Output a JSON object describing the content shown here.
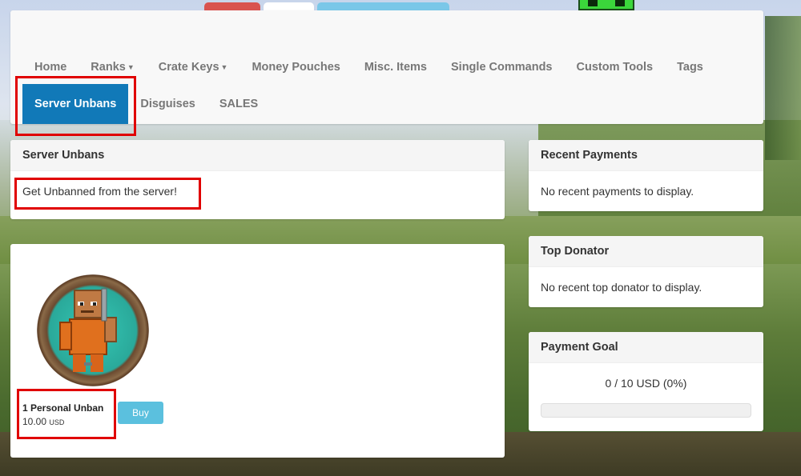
{
  "nav": {
    "row1": [
      {
        "label": "Home",
        "dropdown": false
      },
      {
        "label": "Ranks",
        "dropdown": true
      },
      {
        "label": "Crate Keys",
        "dropdown": true
      },
      {
        "label": "Money Pouches",
        "dropdown": false
      },
      {
        "label": "Misc. Items",
        "dropdown": false
      },
      {
        "label": "Single Commands",
        "dropdown": false
      },
      {
        "label": "Custom Tools",
        "dropdown": false
      },
      {
        "label": "Tags",
        "dropdown": false
      }
    ],
    "row2": [
      {
        "label": "Server Unbans",
        "active": true
      },
      {
        "label": "Disguises",
        "active": false
      },
      {
        "label": "SALES",
        "active": false
      }
    ],
    "active_color": "#1179b8"
  },
  "category": {
    "title": "Server Unbans",
    "description": "Get Unbanned from the server!"
  },
  "package": {
    "name": "1 Personal Unban",
    "price": "10.00",
    "currency": "USD",
    "buy_label": "Buy",
    "image_icon": "unban-prisoner-image"
  },
  "sidebar": {
    "recent_payments": {
      "title": "Recent Payments",
      "text": "No recent payments to display."
    },
    "top_donator": {
      "title": "Top Donator",
      "text": "No recent top donator to display."
    },
    "payment_goal": {
      "title": "Payment Goal",
      "text": "0 / 10 USD (0%)",
      "progress_fraction": 0
    }
  },
  "colors": {
    "highlight": "#e00000",
    "buy_button": "#5bc0de"
  }
}
